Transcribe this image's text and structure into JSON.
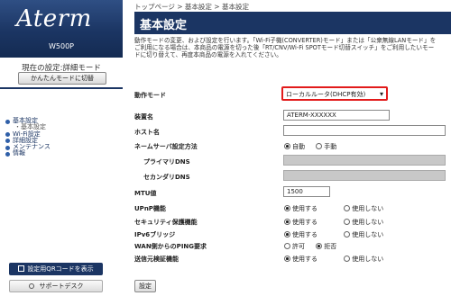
{
  "sidebar": {
    "logo": "Aterm",
    "model": "W500P",
    "current_mode_label": "現在の設定:詳細モード",
    "easy_mode_button": "かんたんモードに切替",
    "nav": [
      {
        "label": "基本設定",
        "sub": false
      },
      {
        "label": "・基本設定",
        "sub": true
      },
      {
        "label": "Wi-Fi設定",
        "sub": false
      },
      {
        "label": "詳細設定",
        "sub": false
      },
      {
        "label": "メンテナンス",
        "sub": false
      },
      {
        "label": "情報",
        "sub": false
      }
    ],
    "qr_button": "設定用QRコードを表示",
    "support_button": "サポートデスク"
  },
  "main": {
    "breadcrumb": "トップページ > 基本設定 > 基本設定",
    "title": "基本設定",
    "description": "動作モードの変更、および設定を行います。「Wi-Fi子機(CONVERTER)モード」または「公衆無線LANモード」をご利用になる場合は、本商品の電源を切った後「RT/CNV/Wi-Fi SPOTモード切替スイッチ」をご利用したいモードに切り替えて、再度本商品の電源を入れてください。",
    "form": {
      "mode_label": "動作モード",
      "mode_value": "ローカルルータ(DHCP有効)",
      "device_name_label": "装置名",
      "device_name_value": "ATERM-XXXXXX",
      "host_name_label": "ホスト名",
      "host_name_value": "",
      "dns_method_label": "ネームサーバ設定方法",
      "dns_auto": "自動",
      "dns_manual": "手動",
      "primary_dns_label": "プライマリDNS",
      "secondary_dns_label": "セカンダリDNS",
      "mtu_label": "MTU値",
      "mtu_value": "1500",
      "upnp_label": "UPnP機能",
      "security_label": "セキュリティ保護機能",
      "ipv6_label": "IPv6ブリッジ",
      "ping_label": "WAN側からのPING要求",
      "checksum_label": "送信元検証機能",
      "use": "使用する",
      "not_use": "使用しない",
      "allow": "許可",
      "deny": "拒否"
    },
    "set_button": "設定"
  }
}
